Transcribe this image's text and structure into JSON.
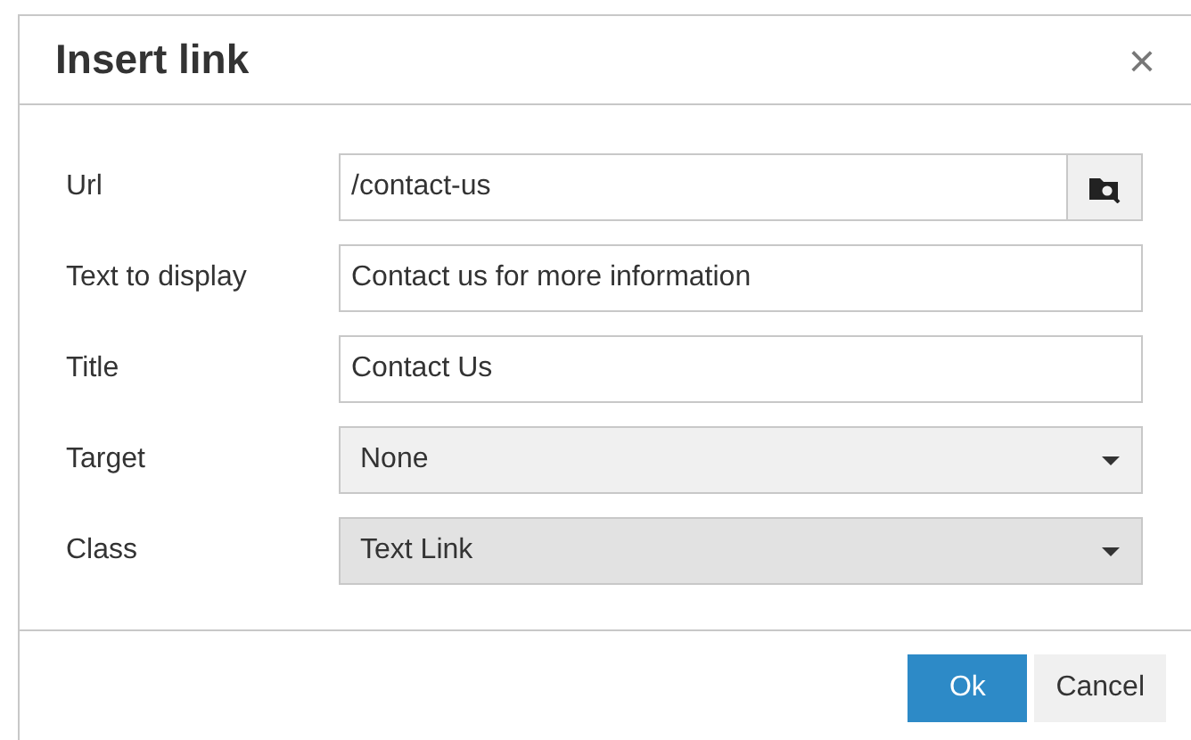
{
  "dialog": {
    "title": "Insert link",
    "close": "×"
  },
  "fields": [
    {
      "kind": "browse",
      "label": "Url",
      "value": "/contact-us"
    },
    {
      "kind": "text",
      "label": "Text to display",
      "value": "Contact us for more information"
    },
    {
      "kind": "text",
      "label": "Title",
      "value": "Contact Us"
    },
    {
      "kind": "select",
      "label": "Target",
      "value": "None",
      "highlighted": false
    },
    {
      "kind": "select",
      "label": "Class",
      "value": "Text Link",
      "highlighted": true
    }
  ],
  "buttons": [
    {
      "label": "Ok",
      "primary": true
    },
    {
      "label": "Cancel",
      "primary": false
    }
  ]
}
